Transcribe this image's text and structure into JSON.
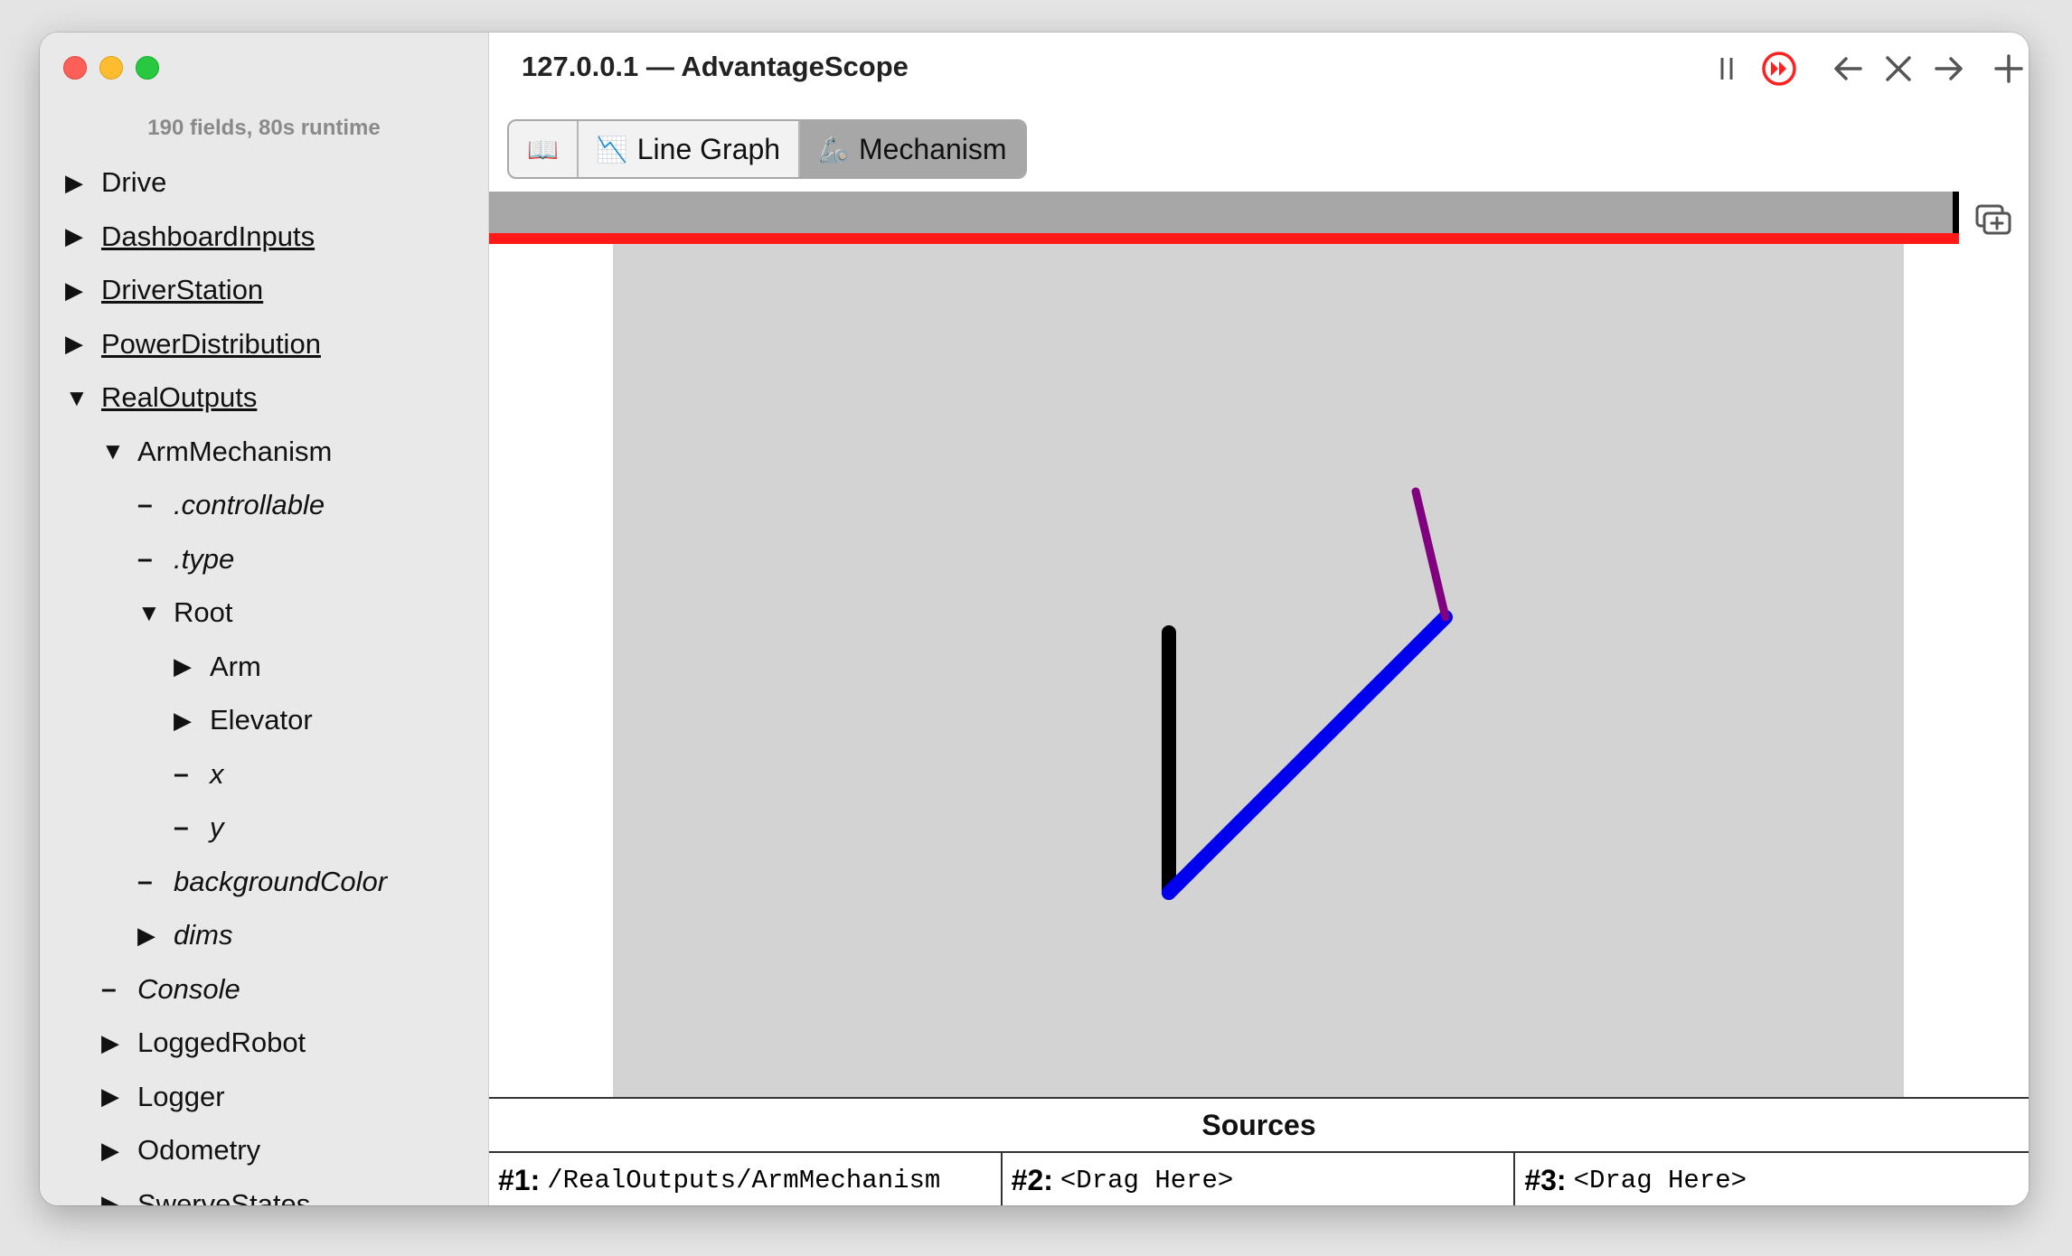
{
  "window": {
    "title": "127.0.0.1 — AdvantageScope"
  },
  "sidebar": {
    "log_info": "190 fields, 80s runtime",
    "tree": [
      {
        "label": "Drive",
        "marker": "▶",
        "style": "plain"
      },
      {
        "label": "DashboardInputs",
        "marker": "▶",
        "style": "link"
      },
      {
        "label": "DriverStation",
        "marker": "▶",
        "style": "link"
      },
      {
        "label": "PowerDistribution",
        "marker": "▶",
        "style": "link"
      },
      {
        "label": "RealOutputs",
        "marker": "▼",
        "style": "link"
      },
      {
        "label": "ArmMechanism",
        "marker": "▼",
        "style": "plain"
      },
      {
        "label": ".controllable",
        "marker": "–",
        "style": "italic"
      },
      {
        "label": ".type",
        "marker": "–",
        "style": "italic"
      },
      {
        "label": "Root",
        "marker": "▼",
        "style": "plain"
      },
      {
        "label": "Arm",
        "marker": "▶",
        "style": "plain"
      },
      {
        "label": "Elevator",
        "marker": "▶",
        "style": "plain"
      },
      {
        "label": "x",
        "marker": "–",
        "style": "italic"
      },
      {
        "label": "y",
        "marker": "–",
        "style": "italic"
      },
      {
        "label": "backgroundColor",
        "marker": "–",
        "style": "italic"
      },
      {
        "label": "dims",
        "marker": "▶",
        "style": "italic"
      },
      {
        "label": "Console",
        "marker": "–",
        "style": "italic"
      },
      {
        "label": "LoggedRobot",
        "marker": "▶",
        "style": "plain"
      },
      {
        "label": "Logger",
        "marker": "▶",
        "style": "plain"
      },
      {
        "label": "Odometry",
        "marker": "▶",
        "style": "plain"
      },
      {
        "label": "SwerveStates",
        "marker": "▶",
        "style": "plain"
      }
    ]
  },
  "controls": {
    "pause_icon": "pause-icon",
    "live_icon": "live-fast-forward-icon",
    "back_icon": "arrow-left-icon",
    "close_icon": "close-icon",
    "forward_icon": "arrow-right-icon",
    "add_icon": "plus-icon"
  },
  "tabs": [
    {
      "label": "",
      "icon": "📖",
      "icon_name": "book-icon"
    },
    {
      "label": "Line Graph",
      "icon": "📉",
      "icon_name": "line-graph-icon"
    },
    {
      "label": "Mechanism",
      "icon": "🦾",
      "icon_name": "mechanical-arm-icon"
    }
  ],
  "colors": {
    "timeline_bar": "#a7a7a7",
    "timeline_indicator": "#ff1a1a",
    "mechanism_background": "#d3d3d3",
    "elevator": "#000000",
    "arm": "#0000ee",
    "wrist": "#800080"
  },
  "mechanism": {
    "background_color": "#d3d3d3"
  },
  "sources": {
    "title": "Sources",
    "items": [
      {
        "num": "#1:",
        "value": "/RealOutputs/ArmMechanism"
      },
      {
        "num": "#2:",
        "value": "<Drag Here>"
      },
      {
        "num": "#3:",
        "value": "<Drag Here>"
      }
    ]
  }
}
